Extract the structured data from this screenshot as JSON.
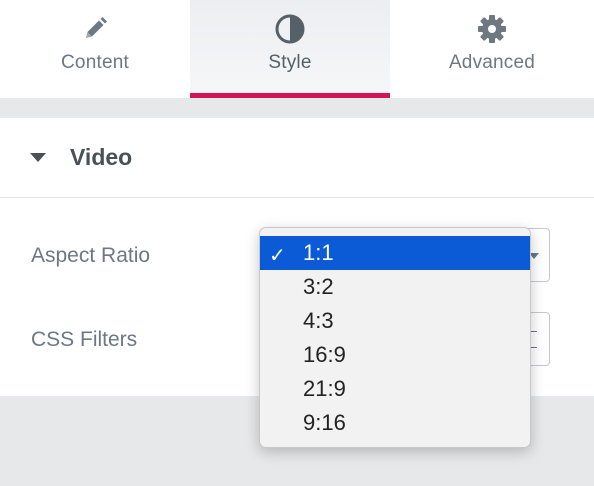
{
  "tabs": [
    {
      "label": "Content",
      "icon": "pencil-icon",
      "active": false
    },
    {
      "label": "Style",
      "icon": "half-circle-icon",
      "active": true
    },
    {
      "label": "Advanced",
      "icon": "gear-icon",
      "active": false
    }
  ],
  "accent_color": "#d4135b",
  "section": {
    "title": "Video",
    "expanded": true
  },
  "controls": {
    "aspect_ratio": {
      "label": "Aspect Ratio",
      "value": "1:1"
    },
    "css_filters": {
      "label": "CSS Filters"
    }
  },
  "dropdown": {
    "selected_color": "#0c5bd6",
    "check_glyph": "✓",
    "options": [
      "1:1",
      "3:2",
      "4:3",
      "16:9",
      "21:9",
      "9:16"
    ],
    "selected": "1:1"
  }
}
